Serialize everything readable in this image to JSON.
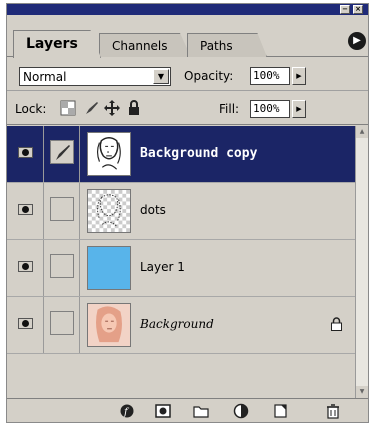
{
  "tabs": [
    {
      "label": "Layers",
      "active": true
    },
    {
      "label": "Channels",
      "active": false
    },
    {
      "label": "Paths",
      "active": false
    }
  ],
  "blend_mode": "Normal",
  "opacity": {
    "label": "Opacity:",
    "value": "100%"
  },
  "lock": {
    "label": "Lock:"
  },
  "fill": {
    "label": "Fill:",
    "value": "100%"
  },
  "layers": [
    {
      "name": "Background copy",
      "visible": true,
      "selected": true,
      "linked": true,
      "thumb": "portrait-sketch",
      "italic": false,
      "locked": false
    },
    {
      "name": "dots",
      "visible": true,
      "selected": false,
      "linked": false,
      "thumb": "dotted-portrait",
      "italic": false,
      "locked": false
    },
    {
      "name": "Layer 1",
      "visible": true,
      "selected": false,
      "linked": false,
      "thumb": "solid-blue",
      "italic": false,
      "locked": false
    },
    {
      "name": "Background",
      "visible": true,
      "selected": false,
      "linked": false,
      "thumb": "photo-portrait",
      "italic": true,
      "locked": true
    }
  ],
  "colors": {
    "selected_row": "#1b2566",
    "titlebar": "#1f2a78",
    "panel": "#d4d0c8",
    "layer1_fill": "#58b4ea"
  },
  "footer_icons": [
    "layer-style-icon",
    "mask-icon",
    "new-set-icon",
    "adjustment-layer-icon",
    "new-layer-icon",
    "trash-icon"
  ]
}
